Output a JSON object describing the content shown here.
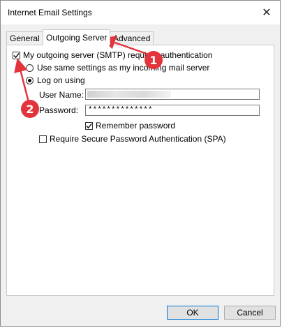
{
  "window": {
    "title": "Internet Email Settings",
    "close_glyph": "✕"
  },
  "tabs": [
    {
      "label": "General",
      "active": false
    },
    {
      "label": "Outgoing Server",
      "active": true
    },
    {
      "label": "Advanced",
      "active": false
    }
  ],
  "outgoing": {
    "requires_auth": {
      "label": "My outgoing server (SMTP) requires authentication",
      "checked": true
    },
    "use_same": {
      "label": "Use same settings as my incoming mail server",
      "selected": false
    },
    "log_on_using": {
      "label": "Log on using",
      "selected": true
    },
    "user_name": {
      "label": "User Name:",
      "value": ""
    },
    "password": {
      "label": "Password:",
      "value": "**************"
    },
    "remember_password": {
      "label": "Remember password",
      "checked": true
    },
    "spa": {
      "label": "Require Secure Password Authentication (SPA)",
      "checked": false
    }
  },
  "buttons": {
    "ok": "OK",
    "cancel": "Cancel"
  },
  "annotations": {
    "badge1": "1",
    "badge2": "2",
    "color": "#e3343c"
  }
}
